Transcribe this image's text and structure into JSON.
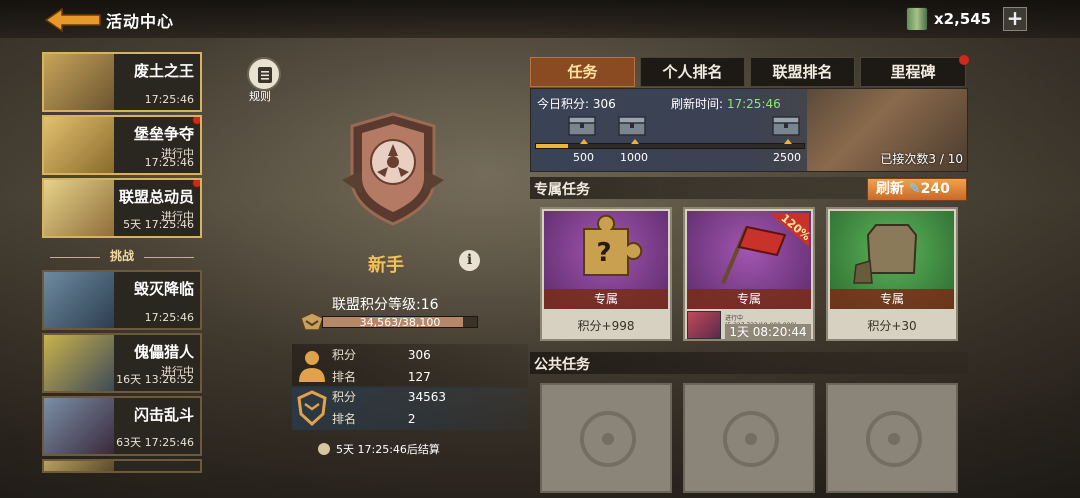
{
  "header": {
    "title": "活动中心",
    "currency_amount": "x2,545",
    "plus_label": "+"
  },
  "events": [
    {
      "name": "废土之王",
      "status": "",
      "time": "17:25:46",
      "active": true,
      "has_dot": false
    },
    {
      "name": "堡垒争夺",
      "status": "进行中",
      "time": "17:25:46",
      "active": true,
      "has_dot": true
    },
    {
      "name": "联盟总动员",
      "status": "进行中",
      "time": "5天 17:25:46",
      "active": true,
      "has_dot": true
    },
    {
      "name": "毁灭降临",
      "status": "",
      "time": "17:25:46",
      "active": false,
      "has_dot": false
    },
    {
      "name": "傀儡猎人",
      "status": "进行中",
      "time": "16天 13:26:52",
      "active": false,
      "has_dot": false
    },
    {
      "name": "闪击乱斗",
      "status": "",
      "time": "63天 17:25:46",
      "active": false,
      "has_dot": false
    }
  ],
  "challenge_divider": "挑战",
  "rules_label": "规则",
  "center": {
    "rank_name": "新手",
    "info_label": "i",
    "level_text": "联盟积分等级:16",
    "level_value": "34,563/38,100",
    "level_fraction": 0.907,
    "personal": {
      "score_label": "积分",
      "score": "306",
      "rank_label": "排名",
      "rank": "127"
    },
    "alliance": {
      "score_label": "积分",
      "score": "34563",
      "rank_label": "排名",
      "rank": "2"
    },
    "countdown": "5天 17:25:46后结算"
  },
  "tabs": [
    {
      "label": "任务",
      "active": true
    },
    {
      "label": "个人排名",
      "active": false
    },
    {
      "label": "联盟排名",
      "active": false
    },
    {
      "label": "里程碑",
      "active": false
    }
  ],
  "progress": {
    "score_text": "今日积分: 306",
    "refresh_label": "刷新时间: ",
    "refresh_time": "17:25:46",
    "milestones": [
      "500",
      "1000",
      "2500"
    ],
    "fill_fraction": 0.12,
    "attempts": "已接次数3 / 10"
  },
  "exclusive": {
    "title": "专属任务",
    "refresh_label": "刷新",
    "refresh_cost": "240",
    "cards": [
      {
        "band": "专属",
        "reward": "积分+998",
        "color": "purple"
      },
      {
        "band": "专属",
        "badge": "120%",
        "ongoing": "进行中 (5,327,733/18,000,000)",
        "timer": "1天 08:20:44",
        "color": "purple"
      },
      {
        "band": "专属",
        "reward": "积分+30",
        "color": "green"
      }
    ]
  },
  "public": {
    "title": "公共任务"
  }
}
